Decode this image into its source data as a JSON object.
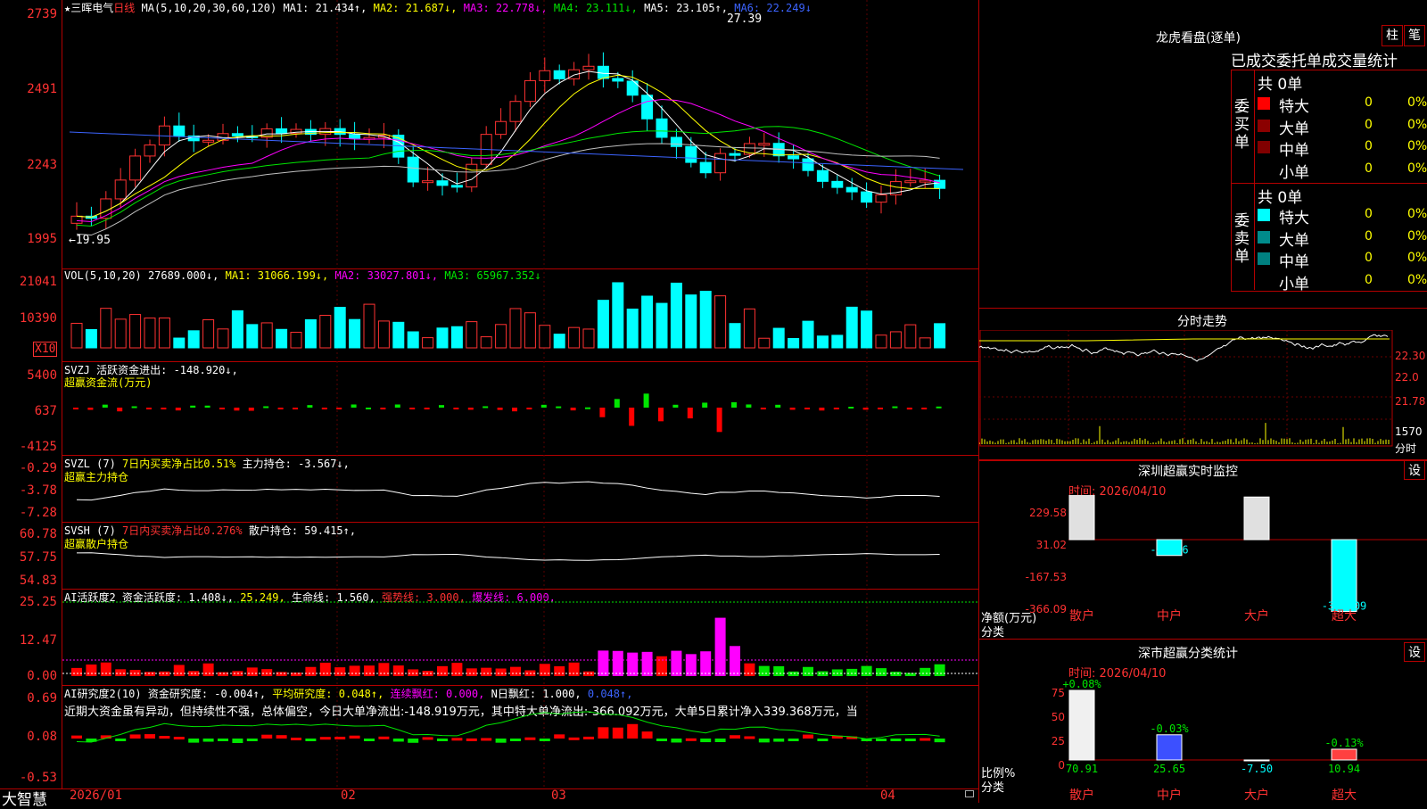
{
  "stock": {
    "star": "★",
    "name": "三晖电气",
    "period": "日线"
  },
  "main_ma": {
    "label": "MA(5,10,20,30,60,120)",
    "ma1": "MA1: 21.434↑,",
    "ma2": "MA2: 21.687↓,",
    "ma3": "MA3: 22.778↓,",
    "ma4": "MA4: 23.111↓,",
    "ma5": "MA5: 23.105↑,",
    "ma6": "MA6: 22.249↓"
  },
  "price_axis": [
    "2739",
    "2491",
    "2243",
    "1995"
  ],
  "annot_high": "27.39",
  "annot_low": "←19.95",
  "vol": {
    "label": "VOL(5,10,20)",
    "value": "27689.000↓,",
    "ma1": "MA1: 31066.199↓,",
    "ma2": "MA2: 33027.801↓,",
    "ma3": "MA3: 65967.352↓",
    "axis": [
      "21041",
      "10390"
    ],
    "unit": "X10"
  },
  "svzj": {
    "label": "SVZJ  活跃资金进出: -148.920↓,",
    "sub": "超赢资金流(万元)",
    "axis": [
      "5400",
      "637",
      "-4125"
    ]
  },
  "svzl": {
    "label": "SVZL (7)",
    "ratio": "7日内买卖净占比0.51%",
    "hold": "主力持仓: -3.567↓,",
    "sub": "超赢主力持仓",
    "axis": [
      "-0.29",
      "-3.78",
      "-7.28"
    ]
  },
  "svsh": {
    "label": "SVSH (7)",
    "ratio": "7日内买卖净占比0.276%",
    "hold": "散户持仓: 59.415↑,",
    "sub": "超赢散户持仓",
    "axis": [
      "60.78",
      "57.75",
      "54.83"
    ]
  },
  "ai2": {
    "label": "AI活跃度2",
    "a": "资金活跃度: 1.408↓,",
    "b": "25.249,",
    "c": "生命线: 1.560,",
    "d": "强势线: 3.000,",
    "e": "爆发线: 6.000,",
    "axis": [
      "25.25",
      "12.47",
      "0.00"
    ]
  },
  "ai3": {
    "label": "AI研究度2(10)",
    "a": "资金研究度: -0.004↑,",
    "b": "平均研究度: 0.048↑,",
    "c": "连续飘红: 0.000,",
    "d": "N日飘红: 1.000,",
    "e": "0.048↑,",
    "comment": "近期大资金虽有异动，但持续性不强，总体偏空，今日大单净流出:-148.919万元，其中特大单净流出:-366.092万元，大单5日累计净入339.368万元，当",
    "axis": [
      "0.69",
      "0.08",
      "-0.53"
    ]
  },
  "xaxis": {
    "brand": "大智慧",
    "labels": [
      "2026/01",
      "02",
      "03",
      "04"
    ]
  },
  "lhb": {
    "title": "龙虎看盘(逐单)",
    "btn1": "柱",
    "btn2": "笔",
    "tab": "已成交委托单成交量统计",
    "buy": {
      "side": "委买单",
      "total": "共 0单",
      "rows": [
        {
          "n": "特大",
          "v": "0",
          "p": "0%"
        },
        {
          "n": "大单",
          "v": "0",
          "p": "0%"
        },
        {
          "n": "中单",
          "v": "0",
          "p": "0%"
        },
        {
          "n": "小单",
          "v": "0",
          "p": "0%"
        }
      ]
    },
    "sell": {
      "side": "委卖单",
      "total": "共 0单",
      "rows": [
        {
          "n": "特大",
          "v": "0",
          "p": "0%"
        },
        {
          "n": "大单",
          "v": "0",
          "p": "0%"
        },
        {
          "n": "中单",
          "v": "0",
          "p": "0%"
        },
        {
          "n": "小单",
          "v": "0",
          "p": "0%"
        }
      ]
    },
    "colors": {
      "buy": [
        "#ff0000",
        "#8b0000",
        "#800000",
        "#000000"
      ],
      "sell": [
        "#00ffff",
        "#008b8b",
        "#008080",
        "#000000"
      ]
    }
  },
  "fenshi": {
    "title": "分时走势",
    "axis": [
      "22.30",
      "22.0",
      "21.78",
      "1570"
    ],
    "unit": "分时"
  },
  "sz_monitor": {
    "title": "深圳超赢实时监控",
    "btn": "设",
    "time": "时间: 2026/04/10",
    "axis": [
      "229.58",
      "31.02",
      "-167.53",
      "-366.09"
    ],
    "ylabel": "净额(万元)",
    "xlabel": "分类",
    "cats": [
      "散户",
      "中户",
      "大户",
      "超大"
    ],
    "values": [
      229.58,
      -80.66,
      217.17,
      -366.09
    ],
    "vlabels": [
      "229.58",
      "-80.66",
      "217.17",
      "-366.09"
    ]
  },
  "sz_class": {
    "title": "深市超赢分类统计",
    "btn": "设",
    "time": "时间: 2026/04/10",
    "axis": [
      "75",
      "50",
      "25",
      "0"
    ],
    "ylabel": "比例%",
    "xlabel": "分类",
    "cats": [
      "散户",
      "中户",
      "大户",
      "超大"
    ],
    "pct": [
      "+0.08%",
      "-0.03%",
      "",
      "-0.13%"
    ],
    "values": [
      70.91,
      25.65,
      -7.5,
      10.94
    ],
    "vlabels": [
      "70.91",
      "25.65",
      "-7.50",
      "10.94"
    ]
  }
}
